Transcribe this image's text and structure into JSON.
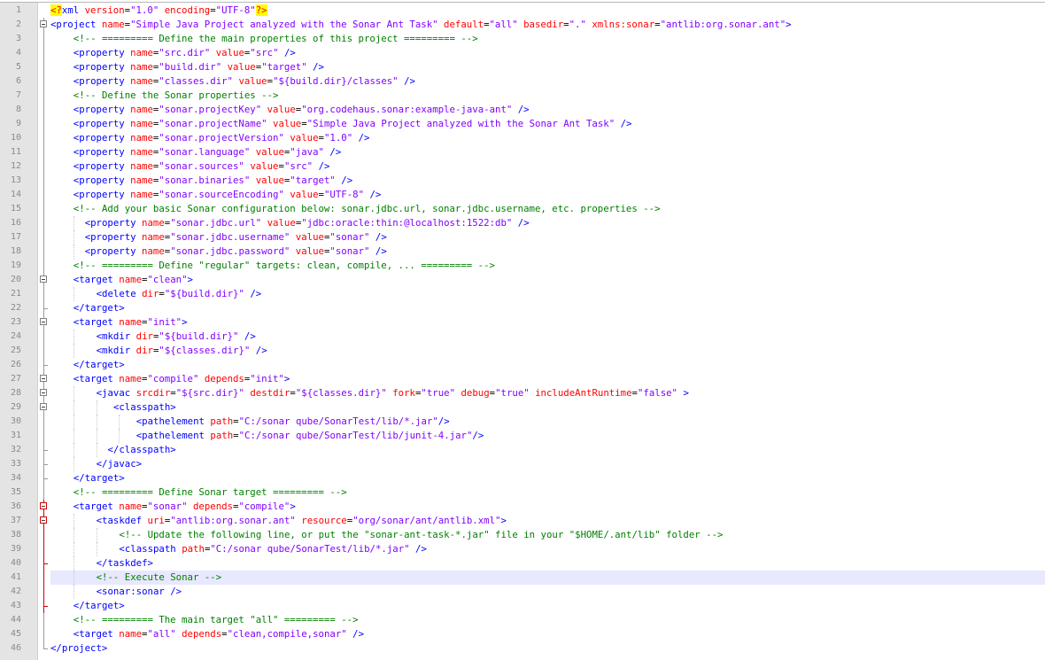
{
  "editor": {
    "colors": {
      "tag": "#0000ff",
      "attribute": "#ff0000",
      "value": "#8000ff",
      "comment": "#008000",
      "pi_background": "#ffff00",
      "current_line": "#e8e8ff",
      "gutter": "#e4e4e4"
    },
    "current_line": 41,
    "lines": [
      {
        "n": "1",
        "indent": 0,
        "fold": "none",
        "html": "<span class='pi-bg'>&lt;?</span><span class='pi-name'>xml</span> <span class='attr'>version</span>=<span class='val'>\"1.0\"</span> <span class='attr'>encoding</span>=<span class='val'>\"UTF-8\"</span><span class='pi-bg'>?&gt;</span>"
      },
      {
        "n": "2",
        "indent": 0,
        "fold": "open",
        "html": "<span class='tag'>&lt;project</span> <span class='attr'>name</span>=<span class='val'>\"Simple Java Project analyzed with the Sonar Ant Task\"</span> <span class='attr'>default</span>=<span class='val'>\"all\"</span> <span class='attr'>basedir</span>=<span class='val'>\".\"</span> <span class='attr'>xmlns:sonar</span>=<span class='val'>\"antlib:org.sonar.ant\"</span><span class='tag'>&gt;</span>"
      },
      {
        "n": "3",
        "indent": 4,
        "fold": "line",
        "html": "<span class='cmt'>&lt;!-- ========= Define the main properties of this project ========= --&gt;</span>"
      },
      {
        "n": "4",
        "indent": 4,
        "fold": "line",
        "html": "<span class='tag'>&lt;property</span> <span class='attr'>name</span>=<span class='val'>\"src.dir\"</span> <span class='attr'>value</span>=<span class='val'>\"src\"</span> <span class='tag'>/&gt;</span>"
      },
      {
        "n": "5",
        "indent": 4,
        "fold": "line",
        "html": "<span class='tag'>&lt;property</span> <span class='attr'>name</span>=<span class='val'>\"build.dir\"</span> <span class='attr'>value</span>=<span class='val'>\"target\"</span> <span class='tag'>/&gt;</span>"
      },
      {
        "n": "6",
        "indent": 4,
        "fold": "line",
        "html": "<span class='tag'>&lt;property</span> <span class='attr'>name</span>=<span class='val'>\"classes.dir\"</span> <span class='attr'>value</span>=<span class='val'>\"${build.dir}/classes\"</span> <span class='tag'>/&gt;</span>"
      },
      {
        "n": "7",
        "indent": 4,
        "fold": "line",
        "html": "<span class='cmt'>&lt;!-- Define the Sonar properties --&gt;</span>"
      },
      {
        "n": "8",
        "indent": 4,
        "fold": "line",
        "html": "<span class='tag'>&lt;property</span> <span class='attr'>name</span>=<span class='val'>\"sonar.projectKey\"</span> <span class='attr'>value</span>=<span class='val'>\"org.codehaus.sonar:example-java-ant\"</span> <span class='tag'>/&gt;</span>"
      },
      {
        "n": "9",
        "indent": 4,
        "fold": "line",
        "html": "<span class='tag'>&lt;property</span> <span class='attr'>name</span>=<span class='val'>\"sonar.projectName\"</span> <span class='attr'>value</span>=<span class='val'>\"Simple Java Project analyzed with the Sonar Ant Task\"</span> <span class='tag'>/&gt;</span>"
      },
      {
        "n": "10",
        "indent": 4,
        "fold": "line",
        "html": "<span class='tag'>&lt;property</span> <span class='attr'>name</span>=<span class='val'>\"sonar.projectVersion\"</span> <span class='attr'>value</span>=<span class='val'>\"1.0\"</span> <span class='tag'>/&gt;</span>"
      },
      {
        "n": "11",
        "indent": 4,
        "fold": "line",
        "html": "<span class='tag'>&lt;property</span> <span class='attr'>name</span>=<span class='val'>\"sonar.language\"</span> <span class='attr'>value</span>=<span class='val'>\"java\"</span> <span class='tag'>/&gt;</span>"
      },
      {
        "n": "12",
        "indent": 4,
        "fold": "line",
        "html": "<span class='tag'>&lt;property</span> <span class='attr'>name</span>=<span class='val'>\"sonar.sources\"</span> <span class='attr'>value</span>=<span class='val'>\"src\"</span> <span class='tag'>/&gt;</span>"
      },
      {
        "n": "13",
        "indent": 4,
        "fold": "line",
        "html": "<span class='tag'>&lt;property</span> <span class='attr'>name</span>=<span class='val'>\"sonar.binaries\"</span> <span class='attr'>value</span>=<span class='val'>\"target\"</span> <span class='tag'>/&gt;</span>"
      },
      {
        "n": "14",
        "indent": 4,
        "fold": "line",
        "html": "<span class='tag'>&lt;property</span> <span class='attr'>name</span>=<span class='val'>\"sonar.sourceEncoding\"</span> <span class='attr'>value</span>=<span class='val'>\"UTF-8\"</span> <span class='tag'>/&gt;</span>"
      },
      {
        "n": "15",
        "indent": 4,
        "fold": "line",
        "html": "<span class='cmt'>&lt;!-- Add your basic Sonar configuration below: sonar.jdbc.url, sonar.jdbc.username, etc. properties --&gt;</span>"
      },
      {
        "n": "16",
        "indent": 6,
        "fold": "line",
        "html": "<span class='tag'>&lt;property</span> <span class='attr'>name</span>=<span class='val'>\"sonar.jdbc.url\"</span> <span class='attr'>value</span>=<span class='val'>\"jdbc:oracle:thin:@localhost:1522:db\"</span> <span class='tag'>/&gt;</span>"
      },
      {
        "n": "17",
        "indent": 6,
        "fold": "line",
        "html": "<span class='tag'>&lt;property</span> <span class='attr'>name</span>=<span class='val'>\"sonar.jdbc.username\"</span> <span class='attr'>value</span>=<span class='val'>\"sonar\"</span> <span class='tag'>/&gt;</span>"
      },
      {
        "n": "18",
        "indent": 6,
        "fold": "line",
        "html": "<span class='tag'>&lt;property</span> <span class='attr'>name</span>=<span class='val'>\"sonar.jdbc.password\"</span> <span class='attr'>value</span>=<span class='val'>\"sonar\"</span> <span class='tag'>/&gt;</span>"
      },
      {
        "n": "19",
        "indent": 4,
        "fold": "line",
        "html": "<span class='cmt'>&lt;!-- ========= Define \"regular\" targets: clean, compile, ... ========= --&gt;</span>"
      },
      {
        "n": "20",
        "indent": 4,
        "fold": "open",
        "html": "<span class='tag'>&lt;target</span> <span class='attr'>name</span>=<span class='val'>\"clean\"</span><span class='tag'>&gt;</span>"
      },
      {
        "n": "21",
        "indent": 8,
        "fold": "line",
        "html": "<span class='tag'>&lt;delete</span> <span class='attr'>dir</span>=<span class='val'>\"${build.dir}\"</span> <span class='tag'>/&gt;</span>"
      },
      {
        "n": "22",
        "indent": 4,
        "fold": "end",
        "html": "<span class='tag'>&lt;/target&gt;</span>"
      },
      {
        "n": "23",
        "indent": 4,
        "fold": "open",
        "html": "<span class='tag'>&lt;target</span> <span class='attr'>name</span>=<span class='val'>\"init\"</span><span class='tag'>&gt;</span>"
      },
      {
        "n": "24",
        "indent": 8,
        "fold": "line",
        "html": "<span class='tag'>&lt;mkdir</span> <span class='attr'>dir</span>=<span class='val'>\"${build.dir}\"</span> <span class='tag'>/&gt;</span>"
      },
      {
        "n": "25",
        "indent": 8,
        "fold": "line",
        "html": "<span class='tag'>&lt;mkdir</span> <span class='attr'>dir</span>=<span class='val'>\"${classes.dir}\"</span> <span class='tag'>/&gt;</span>"
      },
      {
        "n": "26",
        "indent": 4,
        "fold": "end",
        "html": "<span class='tag'>&lt;/target&gt;</span>"
      },
      {
        "n": "27",
        "indent": 4,
        "fold": "open",
        "html": "<span class='tag'>&lt;target</span> <span class='attr'>name</span>=<span class='val'>\"compile\"</span> <span class='attr'>depends</span>=<span class='val'>\"init\"</span><span class='tag'>&gt;</span>"
      },
      {
        "n": "28",
        "indent": 8,
        "fold": "open",
        "html": "<span class='tag'>&lt;javac</span> <span class='attr'>srcdir</span>=<span class='val'>\"${src.dir}\"</span> <span class='attr'>destdir</span>=<span class='val'>\"${classes.dir}\"</span> <span class='attr'>fork</span>=<span class='val'>\"true\"</span> <span class='attr'>debug</span>=<span class='val'>\"true\"</span> <span class='attr'>includeAntRuntime</span>=<span class='val'>\"false\"</span> <span class='tag'>&gt;</span>"
      },
      {
        "n": "29",
        "indent": 11,
        "fold": "open",
        "html": "<span class='tag'>&lt;classpath&gt;</span>"
      },
      {
        "n": "30",
        "indent": 15,
        "fold": "line",
        "html": "<span class='tag'>&lt;pathelement</span> <span class='attr'>path</span>=<span class='val'>\"C:/sonar qube/SonarTest/lib/*.jar\"</span><span class='tag'>/&gt;</span>"
      },
      {
        "n": "31",
        "indent": 15,
        "fold": "line",
        "html": "<span class='tag'>&lt;pathelement</span> <span class='attr'>path</span>=<span class='val'>\"C:/sonar qube/SonarTest/lib/junit-4.jar\"</span><span class='tag'>/&gt;</span>"
      },
      {
        "n": "32",
        "indent": 10,
        "fold": "end",
        "html": "<span class='tag'>&lt;/classpath&gt;</span>"
      },
      {
        "n": "33",
        "indent": 8,
        "fold": "end",
        "html": "<span class='tag'>&lt;/javac&gt;</span>"
      },
      {
        "n": "34",
        "indent": 4,
        "fold": "end",
        "html": "<span class='tag'>&lt;/target&gt;</span>"
      },
      {
        "n": "35",
        "indent": 4,
        "fold": "line",
        "html": "<span class='cmt'>&lt;!-- ========= Define Sonar target ========= --&gt;</span>"
      },
      {
        "n": "36",
        "indent": 4,
        "fold": "open-red",
        "html": "<span class='tag'>&lt;target</span> <span class='attr'>name</span>=<span class='val'>\"sonar\"</span> <span class='attr'>depends</span>=<span class='val'>\"compile\"</span><span class='tag'>&gt;</span>"
      },
      {
        "n": "37",
        "indent": 8,
        "fold": "open-red",
        "html": "<span class='tag'>&lt;taskdef</span> <span class='attr'>uri</span>=<span class='val'>\"antlib:org.sonar.ant\"</span> <span class='attr'>resource</span>=<span class='val'>\"org/sonar/ant/antlib.xml\"</span><span class='tag'>&gt;</span>"
      },
      {
        "n": "38",
        "indent": 12,
        "fold": "red",
        "html": "<span class='cmt'>&lt;!-- Update the following line, or put the \"sonar-ant-task-*.jar\" file in your \"$HOME/.ant/lib\" folder --&gt;</span>"
      },
      {
        "n": "39",
        "indent": 12,
        "fold": "red",
        "html": "<span class='tag'>&lt;classpath</span> <span class='attr'>path</span>=<span class='val'>\"C:/sonar qube/SonarTest/lib/*.jar\"</span> <span class='tag'>/&gt;</span>"
      },
      {
        "n": "40",
        "indent": 8,
        "fold": "end-red",
        "html": "<span class='tag'>&lt;/taskdef&gt;</span>"
      },
      {
        "n": "41",
        "indent": 8,
        "fold": "red",
        "html": "<span class='cmt'>&lt;!-- Execute Sonar --&gt;</span>"
      },
      {
        "n": "42",
        "indent": 8,
        "fold": "red",
        "html": "<span class='tag'>&lt;sonar:sonar</span> <span class='tag'>/&gt;</span>"
      },
      {
        "n": "43",
        "indent": 4,
        "fold": "end-red",
        "html": "<span class='tag'>&lt;/target&gt;</span>"
      },
      {
        "n": "44",
        "indent": 4,
        "fold": "line",
        "html": "<span class='cmt'>&lt;!-- ========= The main target \"all\" ========= --&gt;</span>"
      },
      {
        "n": "45",
        "indent": 4,
        "fold": "line",
        "html": "<span class='tag'>&lt;target</span> <span class='attr'>name</span>=<span class='val'>\"all\"</span> <span class='attr'>depends</span>=<span class='val'>\"clean,compile,sonar\"</span> <span class='tag'>/&gt;</span>"
      },
      {
        "n": "46",
        "indent": 0,
        "fold": "end",
        "html": "<span class='tag'>&lt;/project&gt;</span>"
      }
    ]
  }
}
